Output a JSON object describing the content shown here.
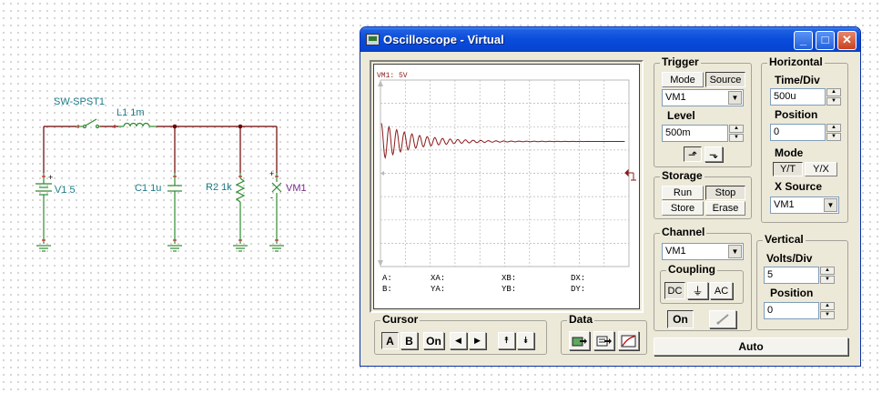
{
  "schematic": {
    "switch_label": "SW-SPST1",
    "inductor_label": "L1 1m",
    "source_label": "V1 5",
    "capacitor_label": "C1 1u",
    "resistor_label": "R2 1k",
    "voltmeter_label": "VM1",
    "plus_sign": "+",
    "minus_sign": "-"
  },
  "window": {
    "title": "Oscilloscope - Virtual",
    "minimize_glyph": "_",
    "maximize_glyph": "□",
    "close_glyph": "✕",
    "icons": {
      "app": "oscilloscope-icon"
    }
  },
  "screen": {
    "channel_tag": "VM1: 5V",
    "cursor_readouts": {
      "a": "A:",
      "b": "B:",
      "xa": "XA:",
      "ya": "YA:",
      "xb": "XB:",
      "yb": "YB:",
      "dx": "DX:",
      "dy": "DY:"
    }
  },
  "trigger": {
    "group": "Trigger",
    "mode_tab": "Mode",
    "source_tab": "Source",
    "source_value": "VM1",
    "level_label": "Level",
    "level_value": "500m",
    "rising_edge_glyph": "⬏",
    "falling_edge_glyph": "⬎"
  },
  "horizontal": {
    "group": "Horizontal",
    "time_div_label": "Time/Div",
    "time_div_value": "500u",
    "position_label": "Position",
    "position_value": "0",
    "mode_label": "Mode",
    "mode_yt": "Y/T",
    "mode_yx": "Y/X",
    "xsource_label": "X Source",
    "xsource_value": "VM1"
  },
  "storage": {
    "group": "Storage",
    "run": "Run",
    "stop": "Stop",
    "store": "Store",
    "erase": "Erase"
  },
  "channel": {
    "group": "Channel",
    "value": "VM1",
    "coupling_group": "Coupling",
    "dc": "DC",
    "gnd_glyph": "⏚",
    "ac": "AC",
    "on": "On",
    "probe_icon": "probe-icon"
  },
  "vertical": {
    "group": "Vertical",
    "volts_div_label": "Volts/Div",
    "volts_div_value": "5",
    "position_label": "Position",
    "position_value": "0"
  },
  "cursor": {
    "group": "Cursor",
    "a": "A",
    "b": "B",
    "on": "On",
    "left_glyph": "◀",
    "right_glyph": "▶",
    "up_glyph": "⯭",
    "down_glyph": "⯯"
  },
  "data": {
    "group": "Data",
    "icons": [
      "export-image-icon",
      "export-data-icon",
      "plot-icon"
    ]
  },
  "auto_button": "Auto",
  "colors": {
    "schematic_wire": "#6b0000",
    "schematic_component": "#2f8a2f",
    "waveform": "#8b1a1a",
    "grid": "#a8a8a8",
    "titlebar": "#0a4cdc"
  }
}
